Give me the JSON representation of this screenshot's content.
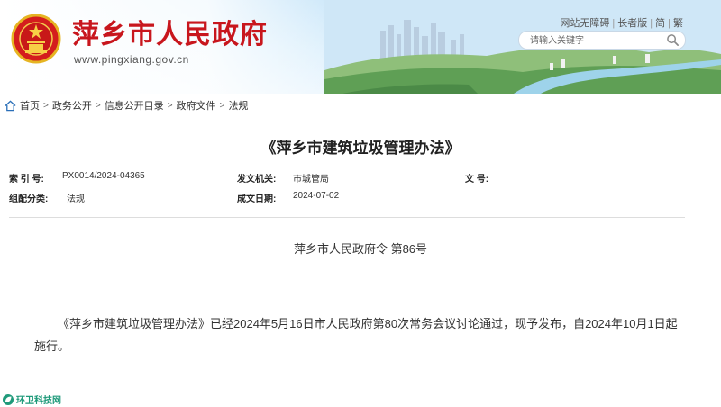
{
  "header": {
    "site_title": "萍乡市人民政府",
    "site_url": "www.pingxiang.gov.cn",
    "links": [
      "网站无障碍",
      "长者版",
      "简",
      "繁"
    ],
    "search_placeholder": "请输入关键字",
    "brand_color": "#c8161d"
  },
  "breadcrumb": {
    "items": [
      "首页",
      "政务公开",
      "信息公开目录",
      "政府文件",
      "法规"
    ]
  },
  "document": {
    "title": "《萍乡市建筑垃圾管理办法》",
    "meta": {
      "index_label": "索 引 号:",
      "index_value": "PX0014/2024-04365",
      "issuer_label": "发文机关:",
      "issuer_value": "市城管局",
      "docno_label": "文 号:",
      "docno_value": "",
      "category_label": "组配分类:",
      "category_value": "法规",
      "date_label": "成文日期:",
      "date_value": "2024-07-02"
    },
    "order": "萍乡市人民政府令  第86号",
    "paragraph": "《萍乡市建筑垃圾管理办法》已经2024年5月16日市人民政府第80次常务会议讨论通过，现予发布，自2024年10月1日起施行。"
  },
  "watermark": {
    "text": "环卫科技网"
  }
}
